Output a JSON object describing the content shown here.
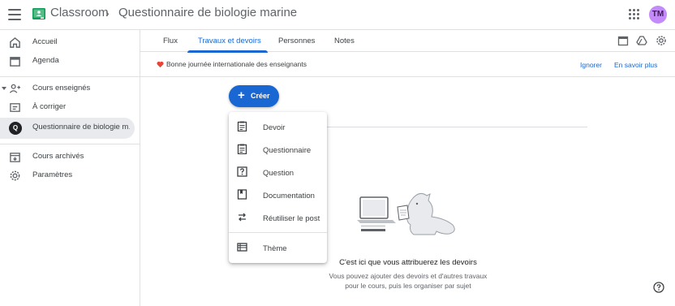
{
  "header": {
    "app_title": "Classroom",
    "breadcrumb_separator": "›",
    "course_title": "Questionnaire de biologie marine",
    "avatar_initials": "TM",
    "avatar_color": "#c58af9"
  },
  "sidebar": {
    "items": [
      {
        "label": "Accueil",
        "icon": "home-icon"
      },
      {
        "label": "Agenda",
        "icon": "calendar-icon"
      },
      {
        "label": "Cours enseignés",
        "icon": "people-icon"
      },
      {
        "label": "À corriger",
        "icon": "todo-icon"
      },
      {
        "label": "Questionnaire de biologie m…",
        "icon": "class-avatar",
        "avatar_letter": "Q",
        "active": true
      },
      {
        "label": "Cours archivés",
        "icon": "archive-icon"
      },
      {
        "label": "Paramètres",
        "icon": "settings-icon"
      }
    ]
  },
  "tabs": [
    {
      "label": "Flux"
    },
    {
      "label": "Travaux et devoirs",
      "active": true
    },
    {
      "label": "Personnes"
    },
    {
      "label": "Notes"
    }
  ],
  "toolbar_icons": [
    "calendar-icon",
    "drive-icon",
    "settings-icon"
  ],
  "banner": {
    "text": "Bonne journée internationale des enseignants",
    "dismiss_label": "Ignorer",
    "learn_more_label": "En savoir plus",
    "heart_color": "#ea4335"
  },
  "create_button": {
    "label": "Créer",
    "icon": "plus-icon",
    "color": "#1967d2"
  },
  "create_menu": {
    "items": [
      {
        "label": "Devoir",
        "icon": "assignment-icon"
      },
      {
        "label": "Questionnaire",
        "icon": "quiz-assignment-icon"
      },
      {
        "label": "Question",
        "icon": "question-icon"
      },
      {
        "label": "Documentation",
        "icon": "material-icon"
      },
      {
        "label": "Réutiliser le post",
        "icon": "reuse-icon"
      },
      {
        "label": "Thème",
        "icon": "topic-icon"
      }
    ]
  },
  "empty_state": {
    "title": "C'est ici que vous attribuerez les devoirs",
    "description_line1": "Vous pouvez ajouter des devoirs et d'autres travaux",
    "description_line2": "pour le cours, puis les organiser par sujet"
  },
  "accent_color": "#1967d2"
}
